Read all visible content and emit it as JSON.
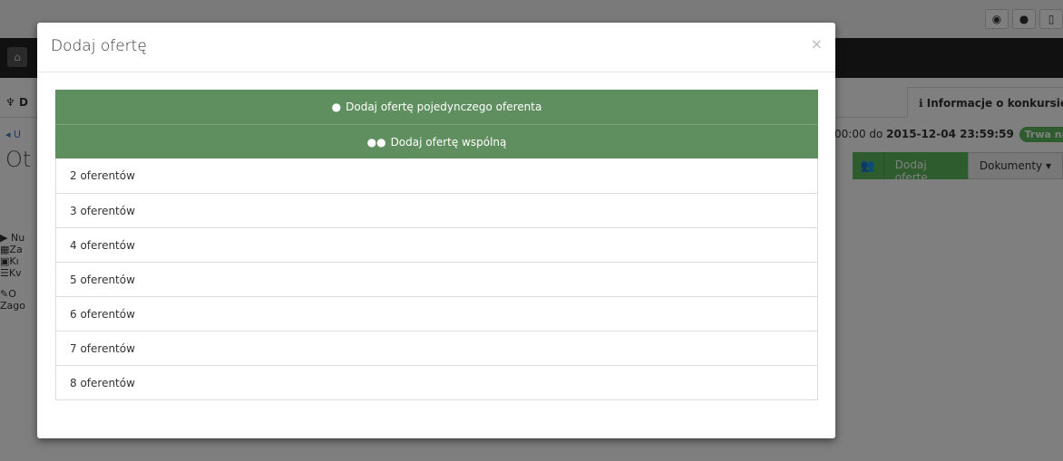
{
  "background": {
    "tab_left": "D",
    "tab_right": "Informacje o konkursie",
    "breadcrumb_left": "U",
    "date_prefix": "00:00 do ",
    "date_end": "2015-12-04 23:59:59",
    "status_badge": "Trwa nabór",
    "title_left": "Ot",
    "add_offer_label": "Dodaj ofertę",
    "documents_label": "Dokumenty ▾",
    "side_items": [
      "Nu",
      "Za",
      "Kı",
      "Kv",
      "O",
      "Zago"
    ]
  },
  "modal": {
    "title": "Dodaj ofertę",
    "close": "×",
    "single_label": "Dodaj ofertę pojedynczego oferenta",
    "joint_label": "Dodaj ofertę wspólną",
    "options": [
      "2 oferentów",
      "3 oferentów",
      "4 oferentów",
      "5 oferentów",
      "6 oferentów",
      "7 oferentów",
      "8 oferentów"
    ]
  },
  "colors": {
    "accent_green": "#5f8f5f",
    "badge_green": "#5cb85c"
  }
}
